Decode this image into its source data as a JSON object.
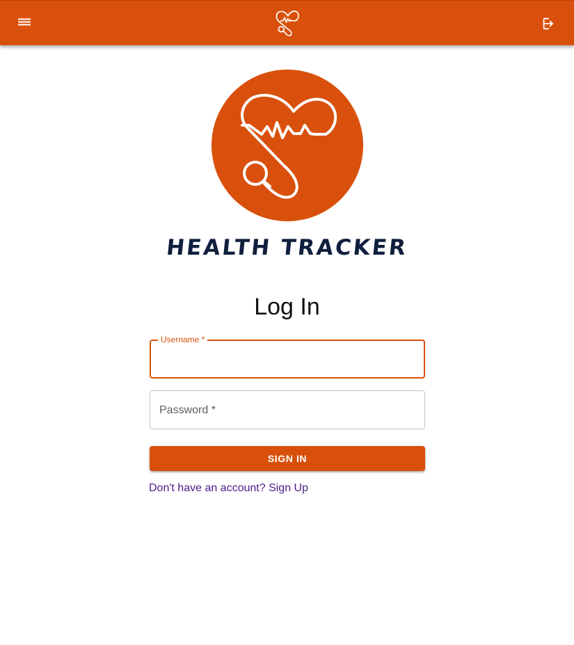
{
  "colors": {
    "primary": "#d9500c",
    "link": "#4b1c88",
    "brand_text": "#0f1f3d"
  },
  "appbar": {
    "menu_icon": "menu-icon",
    "logo_icon": "heart-stethoscope-logo-icon",
    "logout_icon": "logout-icon"
  },
  "brand": {
    "name": "HEALTH TRACKER",
    "logo_icon": "heart-stethoscope-logo-icon"
  },
  "login": {
    "title": "Log In",
    "username_label": "Username *",
    "username_value": "",
    "password_label": "Password *",
    "password_value": "",
    "submit_label": "SIGN IN",
    "signup_text": "Don't have an account? Sign Up"
  }
}
